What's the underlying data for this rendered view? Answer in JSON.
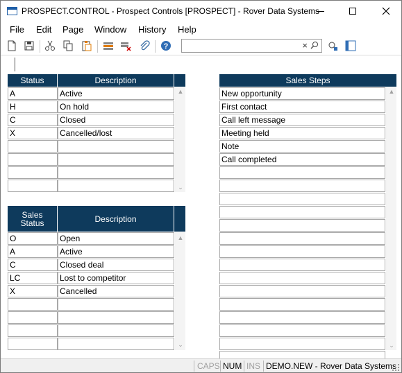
{
  "window": {
    "title": "PROSPECT.CONTROL - Prospect Controls [PROSPECT] - Rover Data Systems"
  },
  "menu": [
    "File",
    "Edit",
    "Page",
    "Window",
    "History",
    "Help"
  ],
  "toolbar": {
    "icons": [
      "new-icon",
      "save-icon",
      "cut-icon",
      "copy-icon",
      "paste-icon",
      "insert-row-icon",
      "delete-row-icon",
      "attach-icon",
      "help-icon",
      "preview-icon",
      "layout-icon"
    ],
    "search_value": "",
    "clear_glyph": "×"
  },
  "status_grid": {
    "headers": [
      "Status",
      "Description"
    ],
    "rows": [
      [
        "A",
        "Active"
      ],
      [
        "H",
        "On hold"
      ],
      [
        "C",
        "Closed"
      ],
      [
        "X",
        "Cancelled/lost"
      ],
      [
        "",
        ""
      ],
      [
        "",
        ""
      ],
      [
        "",
        ""
      ],
      [
        "",
        ""
      ]
    ]
  },
  "sales_status_grid": {
    "headers": [
      "Sales Status",
      "Description"
    ],
    "rows": [
      [
        "O",
        "Open"
      ],
      [
        "A",
        "Active"
      ],
      [
        "C",
        "Closed deal"
      ],
      [
        "LC",
        "Lost to competitor"
      ],
      [
        "X",
        "Cancelled"
      ],
      [
        "",
        ""
      ],
      [
        "",
        ""
      ],
      [
        "",
        ""
      ],
      [
        "",
        ""
      ]
    ]
  },
  "sales_steps_grid": {
    "header": "Sales Steps",
    "rows": [
      "New opportunity",
      "First contact",
      "Call left message",
      "Meeting held",
      "Note",
      "Call completed",
      "",
      "",
      "",
      "",
      "",
      "",
      "",
      "",
      "",
      "",
      "",
      "",
      "",
      "",
      ""
    ]
  },
  "statusbar": {
    "caps": "CAPS",
    "num": "NUM",
    "ins": "INS",
    "context": "DEMO.NEW - Rover Data Systems"
  },
  "colors": {
    "grid_header": "#0e3a5c",
    "indicator_off": "#a0a0a0"
  }
}
